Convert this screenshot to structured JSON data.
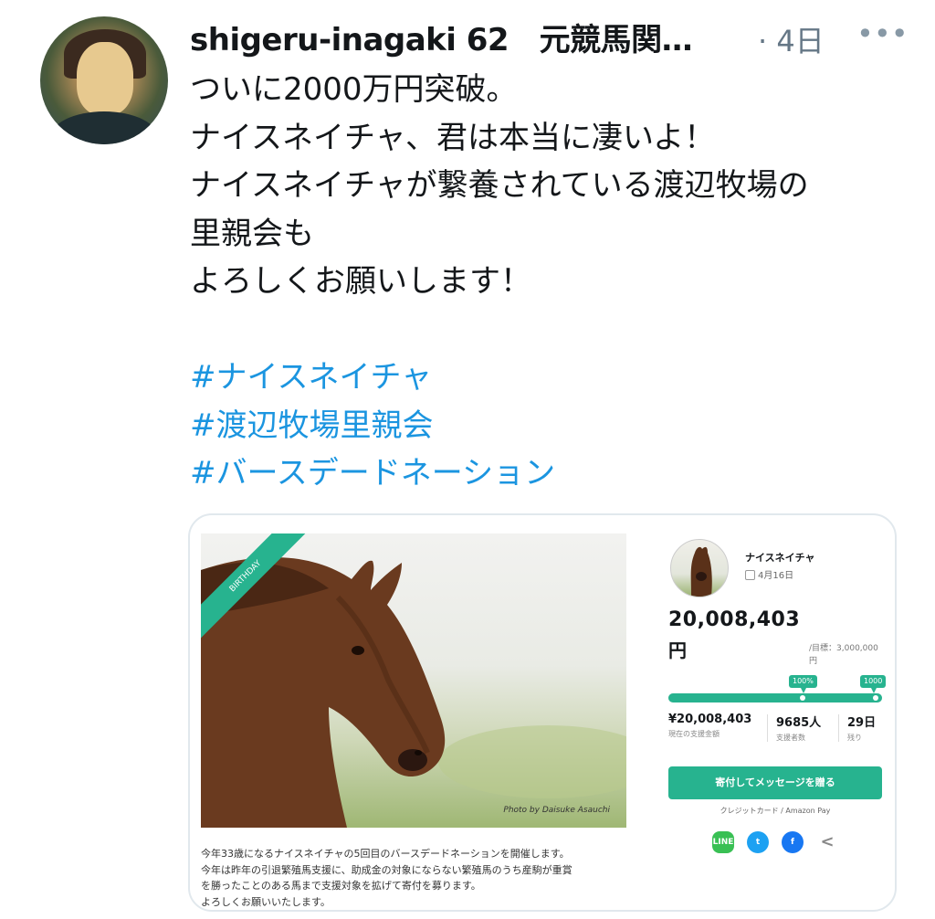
{
  "tweet": {
    "author": "shigeru-inagaki 62　元競馬関…",
    "time": "· 4日",
    "more_icon": "more-icon",
    "text_lines": [
      "ついに2000万円突破。",
      "ナイスネイチャ、君は本当に凄いよ！",
      "ナイスネイチャが繋養されている渡辺牧場の",
      "里親会も",
      "よろしくお願いします！"
    ],
    "hashtags": [
      "#ナイスネイチャ",
      "#渡辺牧場里親会",
      "#バースデードネーション"
    ]
  },
  "card": {
    "ribbon": "BIRTHDAY",
    "photo_credit": "Photo by Daisuke Asauchi",
    "horse_name": "ナイスネイチャ",
    "date": "4月16日",
    "amount": "20,008,403",
    "currency_unit": "円",
    "goal": "/目標：3,000,000",
    "goal_unit": "円",
    "progress_fraction": 1.0,
    "milestones": [
      "100%",
      "1000"
    ],
    "stats": [
      {
        "value": "¥20,008,403",
        "label": "現在の支援金額"
      },
      {
        "value": "9685人",
        "label": "支援者数"
      },
      {
        "value": "29日",
        "label": "残り"
      }
    ],
    "cta_label": "寄付してメッセージを贈る",
    "payment_methods": "クレジットカード / Amazon Pay",
    "share_icons": [
      "line-icon",
      "twitter-icon",
      "facebook-icon",
      "share-icon"
    ],
    "description": [
      "今年33歳になるナイスネイチャの5回目のバースデードネーションを開催します。",
      "今年は昨年の引退繁殖馬支援に、助成金の対象にならない繁殖馬のうち産駒が重賞",
      "を勝ったことのある馬まで支援対象を拡げて寄付を募ります。",
      "よろしくお願いいたします。"
    ],
    "colors": {
      "accent": "#27b38f",
      "hashtag": "#1b95e0"
    }
  }
}
